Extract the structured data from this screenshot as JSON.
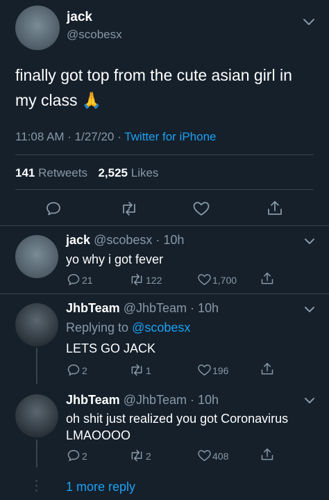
{
  "main_tweet": {
    "name": "jack",
    "handle": "@scobesx",
    "text": "finally got top from the cute asian girl in my class",
    "emoji": "🙏",
    "time": "11:08 AM · 1/27/20 · ",
    "source": "Twitter for iPhone",
    "retweets_count": "141",
    "retweets_label": "Retweets",
    "likes_count": "2,525",
    "likes_label": "Likes"
  },
  "replies": [
    {
      "name": "jack",
      "handle_time": "@scobesx · 10h",
      "text": "yo why i got fever",
      "replies": "21",
      "retweets": "122",
      "likes": "1,700"
    },
    {
      "name": "JhbTeam",
      "handle_time": "@JhbTeam · 10h",
      "replying_to_label": "Replying to",
      "replying_to_handle": "@scobesx",
      "text": "LETS GO JACK",
      "replies": "2",
      "retweets": "1",
      "likes": "196"
    },
    {
      "name": "JhbTeam",
      "handle_time": "@JhbTeam · 10h",
      "text": "oh shit just realized you got Coronavirus LMAOOOO",
      "replies": "2",
      "retweets": "2",
      "likes": "408"
    }
  ],
  "more_replies": "1 more reply",
  "colors": {
    "background": "#15202b",
    "muted": "#8899a6",
    "accent": "#1da1f2",
    "divider": "#38444d"
  }
}
